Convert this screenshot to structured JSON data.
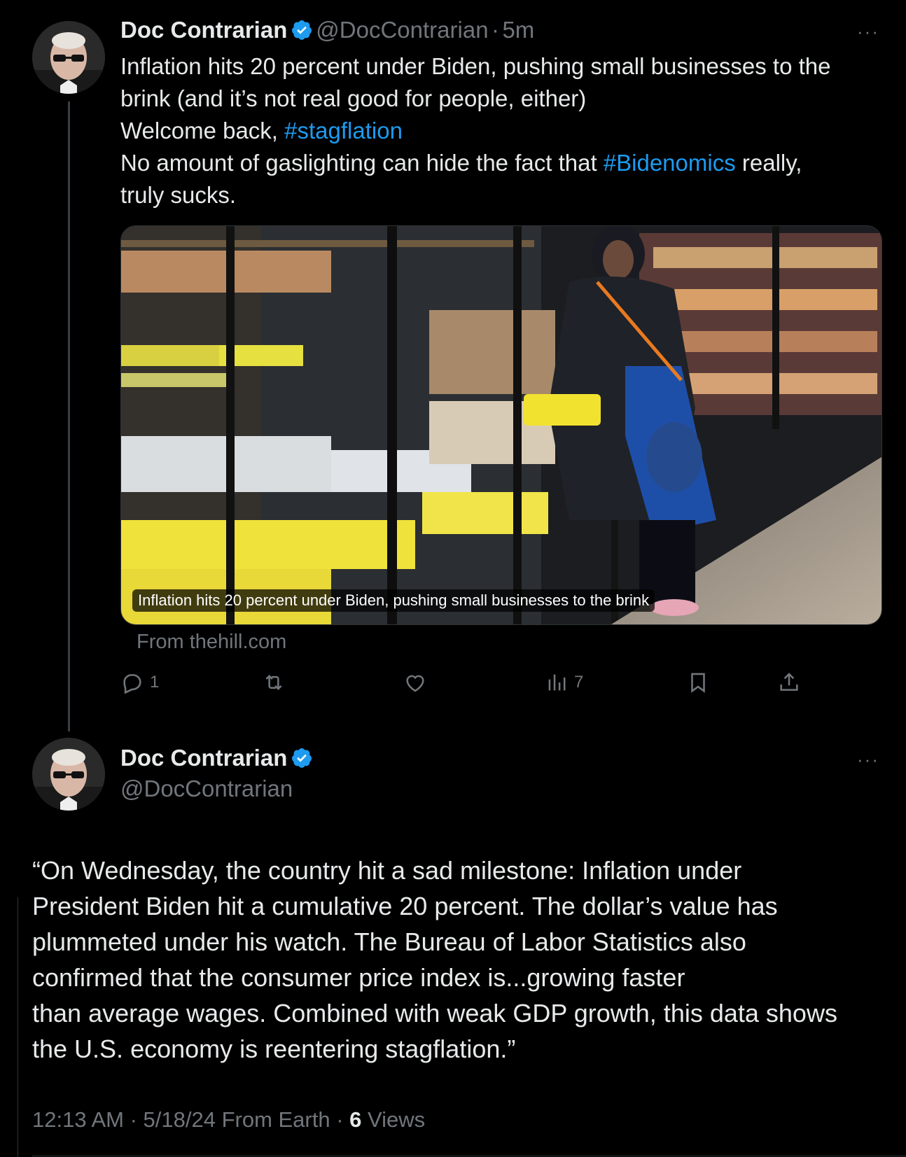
{
  "tweet1": {
    "display_name": "Doc Contrarian",
    "handle": "@DocContrarian",
    "separator": "·",
    "time": "5m",
    "more": "···",
    "text_line1": "Inflation hits 20 percent under Biden, pushing small businesses to the",
    "text_line2": "brink (and it’s not real good for people, either)",
    "text_line3_prefix": "Welcome back, ",
    "hashtag1": "#stagflation",
    "text_line4_prefix": "No amount of gaslighting can hide the fact that ",
    "hashtag2": "#Bidenomics",
    "text_line4_suffix": " really,",
    "text_line5": "truly sucks.",
    "card_caption": "Inflation hits 20 percent under Biden, pushing small businesses to the brink",
    "card_source": "From thehill.com",
    "actions": {
      "reply_count": "1",
      "retweet_count": "",
      "like_count": "",
      "views_count": "7"
    }
  },
  "tweet2": {
    "display_name": "Doc Contrarian",
    "handle": "@DocContrarian",
    "more": "···",
    "quote_lines": [
      "“On Wednesday, the country hit a sad milestone: Inflation under",
      "President Biden hit a cumulative 20 percent. The dollar’s value has",
      "plummeted under his watch. The Bureau of Labor Statistics also",
      "confirmed that the consumer price index is...growing faster",
      "than average wages. Combined with weak GDP growth, this data shows",
      "the U.S. economy is reentering stagflation.”"
    ],
    "meta_time": "12:13 AM · 5/18/24 From Earth · ",
    "views_count": "6",
    "views_label": " Views"
  },
  "colors": {
    "background": "#000000",
    "text": "#e7e9ea",
    "muted": "#71767b",
    "link": "#1d9bf0",
    "verified": "#1d9bf0"
  }
}
